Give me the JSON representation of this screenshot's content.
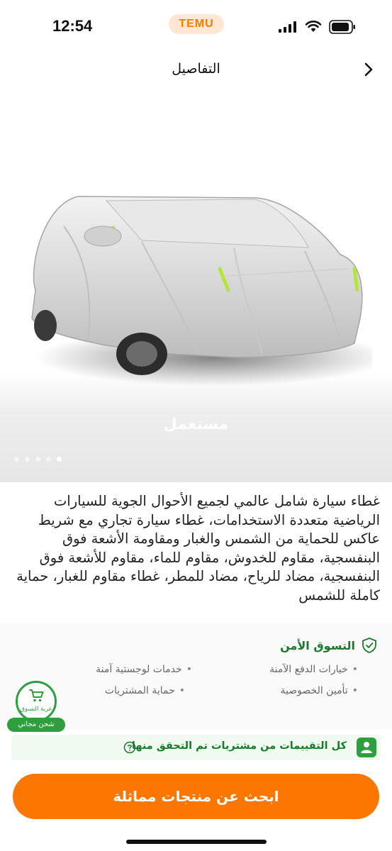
{
  "status_bar": {
    "time": "12:54",
    "app_pill": "TEMU"
  },
  "header": {
    "title": "التفاصيل"
  },
  "gallery": {
    "watermark": "مستعمل",
    "image_count": 5,
    "active_index": 4
  },
  "product": {
    "title": "غطاء سيارة شامل عالمي لجميع الأحوال الجوية للسيارات الرياضية متعددة الاستخدامات، غطاء سيارة تجاري مع شريط عاكس للحماية من الشمس والغبار ومقاومة الأشعة فوق البنفسجية، مقاوم للخدوش، مقاوم للماء، مقاوم للأشعة فوق البنفسجية، مضاد للرياح، مضاد للمطر، غطاء مقاوم للغبار، حماية كاملة للشمس"
  },
  "secure_shopping": {
    "title": "التسوق الأمن",
    "items": [
      "خيارات الدفع الآمنة",
      "خدمات لوجستية آمنة",
      "تأمين الخصوصية",
      "حماية المشتريات"
    ]
  },
  "ship_badge": {
    "circle_label": "عربة التسوق",
    "ribbon": "شحن مجاني"
  },
  "reviews": {
    "text": "كل التقييمات من مشتريات تم التحقق منها"
  },
  "cta": {
    "label": "ابحث عن منتجات مماثلة"
  },
  "colors": {
    "brand_orange": "#fb7701",
    "secure_green": "#1a7a2c",
    "badge_green": "#2e9e3e"
  }
}
